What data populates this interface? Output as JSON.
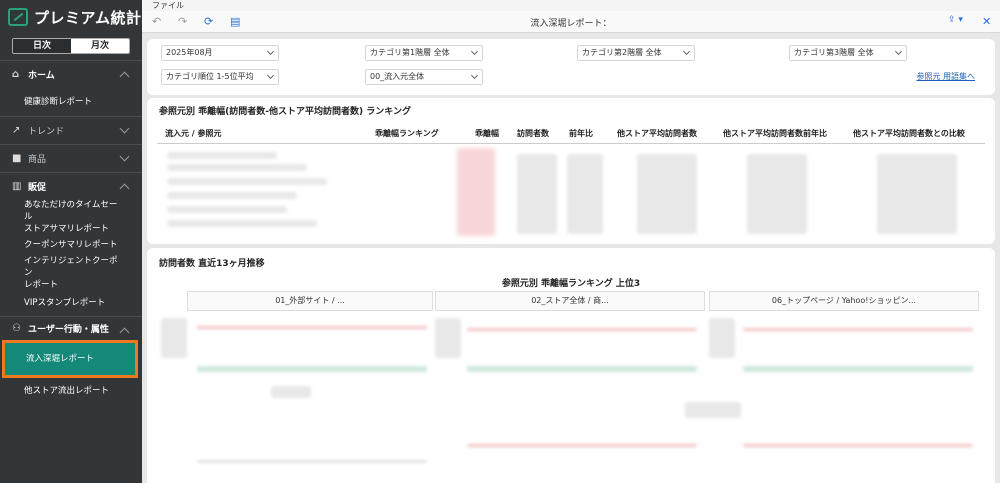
{
  "app": {
    "logo_text": "プレミアム統計",
    "toggle": {
      "day": "日次",
      "month": "月次"
    }
  },
  "sidebar": {
    "home": {
      "label": "ホーム",
      "items": [
        "健康診断レポート"
      ]
    },
    "trend": {
      "label": "トレンド"
    },
    "products": {
      "label": "商品"
    },
    "promo": {
      "label": "販促",
      "items": [
        [
          "あなただけのタイムセール",
          "ストアサマリレポート"
        ],
        [
          "クーポンサマリレポート"
        ],
        [
          "インテリジェントクーポン",
          "レポート"
        ],
        [
          "VIPスタンプレポート"
        ]
      ]
    },
    "user": {
      "label": "ユーザー行動・属性",
      "items": [
        "流入深堀レポート",
        "他ストア流出レポート"
      ],
      "active": "流入深堀レポート"
    }
  },
  "menubar": {
    "file": "ファイル"
  },
  "toolbar": {
    "title": "流入深堀レポート：",
    "undo": "↶",
    "redo": "↷",
    "refresh": "⟳",
    "doc": "▤",
    "share": "⇪ ▾",
    "close": "✕"
  },
  "filters": {
    "month": "2025年08月",
    "cat1": "カテゴリ第1階層  全体",
    "cat2": "カテゴリ第2階層  全体",
    "cat3": "カテゴリ第3階層  全体",
    "cat_rank": "カテゴリ順位  1-5位平均",
    "source": "00_流入元全体",
    "glossary_link": "参照元 用語集へ"
  },
  "ranking": {
    "title": "参照元別 乖離幅(訪問者数-他ストア平均訪問者数) ランキング",
    "headers": [
      "流入元 / 参照元",
      "乖離幅ランキング",
      "乖離幅",
      "訪問者数",
      "前年比",
      "他ストア平均訪問者数",
      "他ストア平均訪問者数前年比",
      "他ストア平均訪問者数との比較"
    ]
  },
  "trend": {
    "title": "訪問者数 直近13ヶ月推移",
    "subtitle": "参照元別 乖離幅ランキング 上位3",
    "columns": [
      "01_外部サイト / ...",
      "02_ストア全体 / 商...",
      "06_トップページ / Yahoo!ショッピン..."
    ]
  },
  "colors": {
    "sidebar_bg": "#333639",
    "active_bg": "#14897a",
    "active_border": "#ef7a1e",
    "link": "#1f5fbf"
  }
}
